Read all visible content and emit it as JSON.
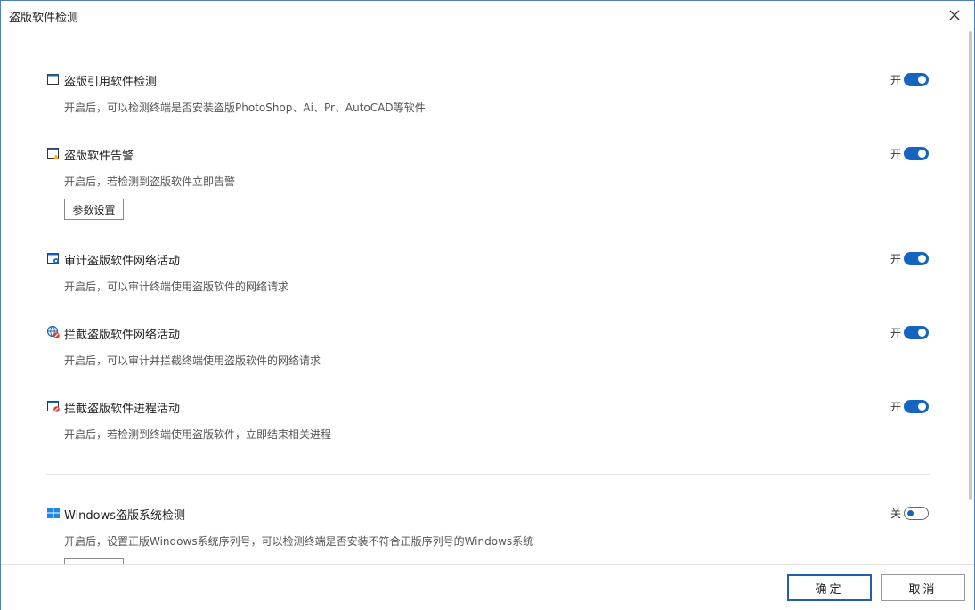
{
  "window": {
    "title": "盗版软件检测"
  },
  "sections": [
    {
      "title": "盗版引用软件检测",
      "desc": "开启后，可以检测终端是否安装盗版PhotoShop、Ai、Pr、AutoCAD等软件",
      "toggle_label": "开",
      "toggle_on": true,
      "icon": "window-icon"
    },
    {
      "title": "盗版软件告警",
      "desc": "开启后，若检测到盗版软件立即告警",
      "toggle_label": "开",
      "toggle_on": true,
      "icon": "window-alert-icon",
      "param_button": "参数设置"
    },
    {
      "title": "审计盗版软件网络活动",
      "desc": "开启后，可以审计终端使用盗版软件的网络请求",
      "toggle_label": "开",
      "toggle_on": true,
      "icon": "window-network-icon"
    },
    {
      "title": "拦截盗版软件网络活动",
      "desc": "开启后，可以审计并拦截终端使用盗版软件的网络请求",
      "toggle_label": "开",
      "toggle_on": true,
      "icon": "globe-block-icon"
    },
    {
      "title": "拦截盗版软件进程活动",
      "desc": "开启后，若检测到终端使用盗版软件，立即结束相关进程",
      "toggle_label": "开",
      "toggle_on": true,
      "icon": "window-block-icon"
    },
    {
      "title": "Windows盗版系统检测",
      "desc": "开启后，设置正版Windows系统序列号，可以检测终端是否安装不符合正版序列号的Windows系统",
      "toggle_label": "关",
      "toggle_on": false,
      "icon": "windows-logo-icon"
    }
  ],
  "footer": {
    "ok_label": "确定",
    "cancel_label": "取消"
  },
  "colors": {
    "accent": "#1565c0",
    "border": "#4f7fb8"
  }
}
